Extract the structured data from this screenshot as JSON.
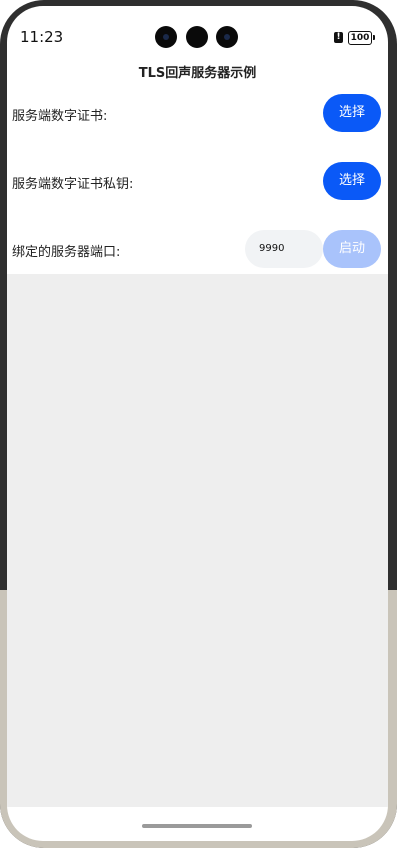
{
  "status_bar": {
    "time": "11:23",
    "battery_alert": "!",
    "battery_level": "100"
  },
  "page": {
    "title": "TLS回声服务器示例"
  },
  "rows": [
    {
      "label": "服务端数字证书:",
      "button": "选择"
    },
    {
      "label": "服务端数字证书私钥:",
      "button": "选择"
    }
  ],
  "port_row": {
    "label": "绑定的服务器端口:",
    "port_value": "9990",
    "start_button": "启动"
  },
  "colors": {
    "accent": "#0a59f7",
    "accent_disabled": "#a9c3fb",
    "content_background": "#eeeeee"
  }
}
